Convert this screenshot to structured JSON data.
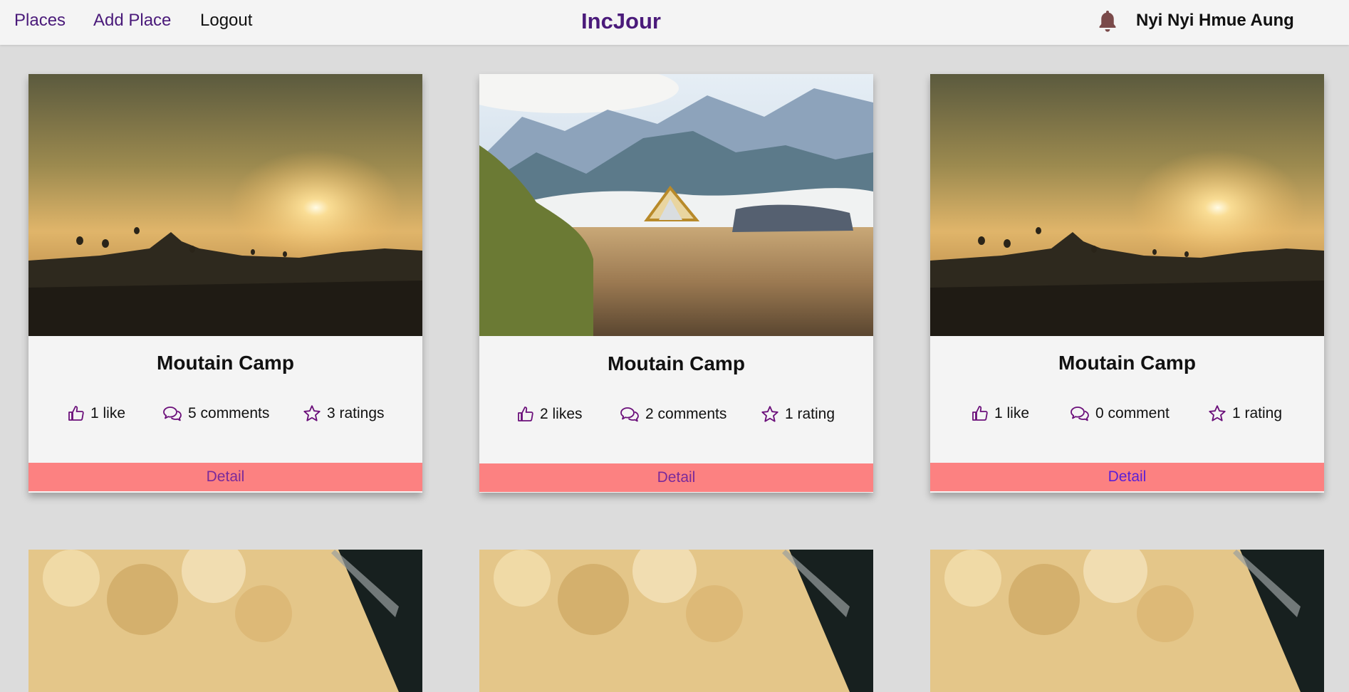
{
  "nav": {
    "links": [
      "Places",
      "Add Place",
      "Logout"
    ],
    "brand": "IncJour",
    "user": "Nyi Nyi Hmue Aung"
  },
  "cards": [
    {
      "title": "Moutain Camp",
      "likes": "1 like",
      "comments": "5 comments",
      "ratings": "3 ratings",
      "detail": "Detail"
    },
    {
      "title": "Moutain Camp",
      "likes": "2 likes",
      "comments": "2 comments",
      "ratings": "1 rating",
      "detail": "Detail"
    },
    {
      "title": "Moutain Camp",
      "likes": "1 like",
      "comments": "0 comment",
      "ratings": "1 rating",
      "detail": "Detail"
    }
  ],
  "colors": {
    "brand": "#4a1a7a",
    "icon": "#6b0f7a",
    "detail_bg": "#fc8181",
    "detail_text": "#7a2a9a",
    "page_bg": "#dcdcdc"
  },
  "icons": [
    "bell-icon",
    "thumbs-up-icon",
    "comments-icon",
    "star-icon"
  ]
}
